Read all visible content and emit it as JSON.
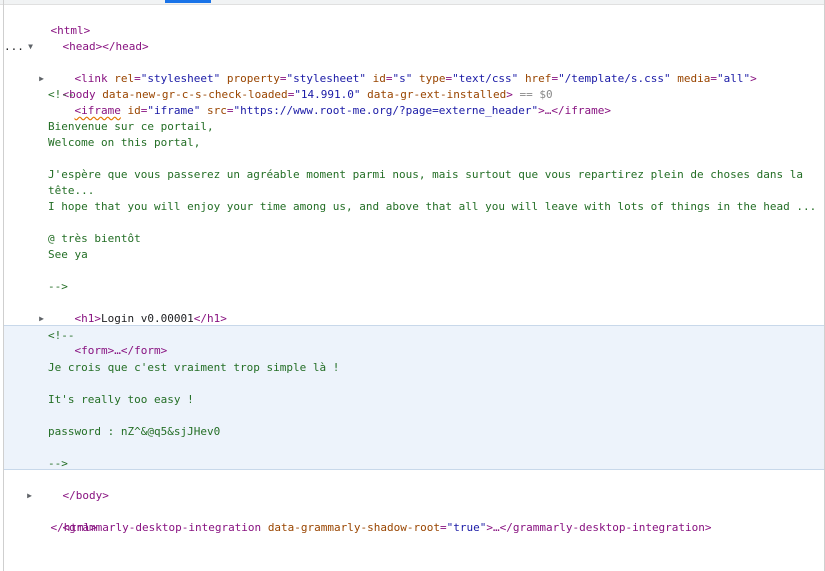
{
  "devtools": {
    "active_tab_color": "#1a73e8"
  },
  "dom": {
    "html_open": "<html>",
    "head_open": "<head>",
    "head_close": "</head>",
    "body_open": "<body",
    "body_attr1_name": "data-new-gr-c-s-check-loaded",
    "body_attr1_value": "\"14.991.0\"",
    "body_attr2_name": "data-gr-ext-installed",
    "body_open_end": ">",
    "body_selected_marker": "== $0",
    "link_open": "<link",
    "link_attrs": [
      {
        "name": "rel",
        "value": "\"stylesheet\""
      },
      {
        "name": "property",
        "value": "\"stylesheet\""
      },
      {
        "name": "id",
        "value": "\"s\""
      },
      {
        "name": "type",
        "value": "\"text/css\""
      },
      {
        "name": "href",
        "value": "\"/template/s.css\""
      },
      {
        "name": "media",
        "value": "\"all\""
      }
    ],
    "link_close": ">",
    "iframe_open": "<iframe",
    "iframe_id_name": "id",
    "iframe_id_value": "\"iframe\"",
    "iframe_src_name": "src",
    "iframe_src_value": "\"https://www.root-me.org/?page=externe_header\"",
    "iframe_collapsed": ">…</iframe>",
    "comment1": [
      "<!--",
      "",
      "Bienvenue sur ce portail,",
      "Welcome on this portal,",
      "",
      "J'espère que vous passerez un agréable moment parmi nous, mais surtout que vous repartirez plein de choses dans la",
      "tête...",
      "I hope that you will enjoy your time among us, and above that all you will leave with lots of things in the head ...",
      "",
      "@ très bientôt",
      "See ya",
      "",
      "-->"
    ],
    "h1_open": "<h1>",
    "h1_text": "Login v0.00001",
    "h1_close": "</h1>",
    "form_collapsed": "<form>…</form>",
    "comment2": [
      "<!--",
      "",
      "Je crois que c'est vraiment trop simple là !",
      "",
      "It's really too easy !",
      "",
      "password : nZ^&@q5&sjJHev0",
      "",
      "-->"
    ],
    "body_close": "</body>",
    "grammarly_open": "<grammarly-desktop-integration",
    "grammarly_attr_name": "data-grammarly-shadow-root",
    "grammarly_attr_value": "\"true\"",
    "grammarly_collapsed": ">…</grammarly-desktop-integration>",
    "html_close": "</html>"
  }
}
